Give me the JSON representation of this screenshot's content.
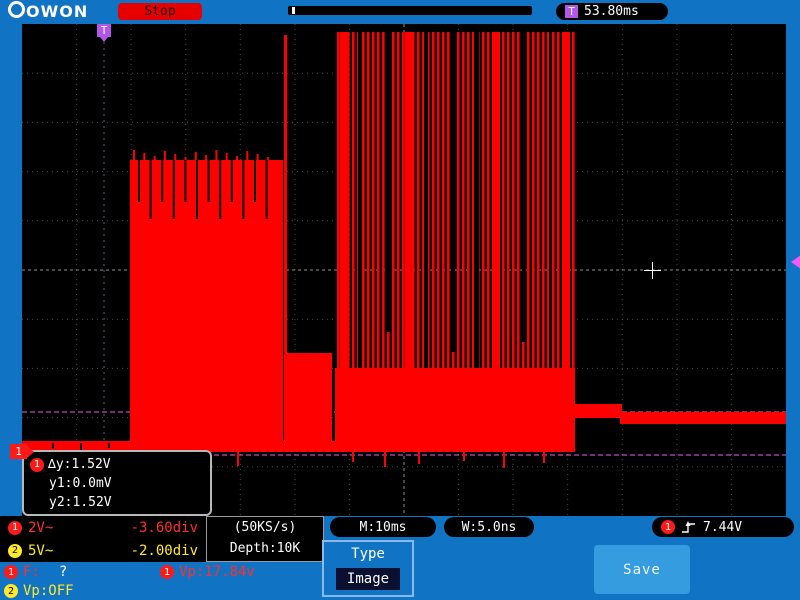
{
  "brand": "OWON",
  "topbar": {
    "state": "Stop",
    "trig_label": "T",
    "trig_time": "53.80ms"
  },
  "markers": {
    "ch1": "1",
    "trigger": "T"
  },
  "cursor_box": {
    "ch": "1",
    "dy": "∆y:1.52V",
    "y1": "y1:0.0mV",
    "y2": "y2:1.52V"
  },
  "status": {
    "ch1_badge": "1",
    "ch1_scale": "2V~",
    "ch1_pos": "-3.60div",
    "ch2_badge": "2",
    "ch2_scale": "5V~",
    "ch2_pos": "-2.00div",
    "sample_rate": "(50KS/s)",
    "depth": "Depth:10K",
    "main_time": "M:10ms",
    "window_time": "W:5.0ns",
    "trig_badge": "1",
    "trig_level": "7.44V",
    "freq_badge": "1",
    "freq_label": "F:",
    "freq_value": "?",
    "vp1_badge": "1",
    "vp1": "Vp:17.84v",
    "vp2_badge": "2",
    "vp2": "Vp:OFF"
  },
  "menu": {
    "type_label": "Type",
    "type_value": "Image",
    "save": "Save"
  },
  "colors": {
    "frame_blue": "#1173c4",
    "waveform_red": "#ff0000",
    "cursor_magenta": "#f25cf2",
    "ch1_red": "#ff2e2e",
    "ch2_yellow": "#ffe92a",
    "stop_red": "#e60000",
    "save_blue": "#359ce0",
    "trigger_violet": "#b257e8"
  }
}
